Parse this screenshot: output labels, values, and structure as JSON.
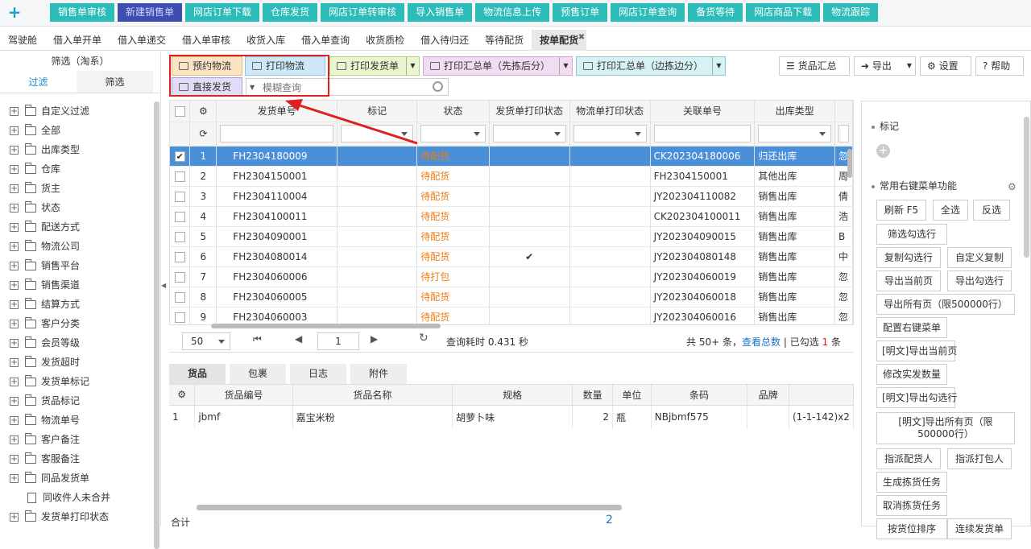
{
  "topnav": {
    "tabs": [
      "销售单审核",
      "新建销售单",
      "网店订单下载",
      "仓库发货",
      "网店订单转审核",
      "导入销售单",
      "物流信息上传",
      "预售订单",
      "网店订单查询",
      "备货等待",
      "网店商品下载",
      "物流跟踪"
    ],
    "selected_index": 1
  },
  "subtabs": [
    "驾驶舱",
    "借入单开单",
    "借入单递交",
    "借入单审核",
    "收货入库",
    "借入单查询",
    "收货质检",
    "借入待归还",
    "等待配货",
    "按单配货"
  ],
  "left": {
    "title": "筛选（淘系）",
    "tabs": [
      "过滤",
      "筛选"
    ],
    "tree": [
      "自定义过滤",
      "全部",
      "出库类型",
      "仓库",
      "货主",
      "状态",
      "配送方式",
      "物流公司",
      "销售平台",
      "销售渠道",
      "结算方式",
      "客户分类",
      "会员等级",
      "发货超时",
      "发货单标记",
      "货品标记",
      "物流单号",
      "客户备注",
      "客服备注",
      "同品发货单",
      "同收件人未合并",
      "发货单打印状态"
    ]
  },
  "toolbar": {
    "reserve_logistics": "预约物流",
    "print_logistics": "打印物流",
    "print_delivery": "打印发货单",
    "print_summary_pick_first": "打印汇总单（先拣后分）",
    "print_summary_pick_while": "打印汇总单（边拣边分）",
    "direct_ship": "直接发货",
    "fuzzy_placeholder": "模糊查询",
    "goods_summary": "货品汇总",
    "export": "导出",
    "settings": "设置",
    "help": "帮助"
  },
  "grid": {
    "columns": [
      "发货单号",
      "标记",
      "状态",
      "发货单打印状态",
      "物流单打印状态",
      "关联单号",
      "出库类型"
    ],
    "rows": [
      {
        "n": "1",
        "no": "FH2304180009",
        "status": "待配货",
        "print": "",
        "ref": "CK202304180006",
        "type": "归还出库",
        "x": "忽",
        "selected": true
      },
      {
        "n": "2",
        "no": "FH2304150001",
        "status": "待配货",
        "print": "",
        "ref": "FH2304150001",
        "type": "其他出库",
        "x": "周",
        "selected": false
      },
      {
        "n": "3",
        "no": "FH2304110004",
        "status": "待配货",
        "print": "",
        "ref": "JY202304110082",
        "type": "销售出库",
        "x": "倩",
        "selected": false
      },
      {
        "n": "4",
        "no": "FH2304100011",
        "status": "待配货",
        "print": "",
        "ref": "CK202304100011",
        "type": "销售出库",
        "x": "浩",
        "selected": false
      },
      {
        "n": "5",
        "no": "FH2304090001",
        "status": "待配货",
        "print": "",
        "ref": "JY202304090015",
        "type": "销售出库",
        "x": "B",
        "selected": false
      },
      {
        "n": "6",
        "no": "FH2304080014",
        "status": "待配货",
        "print": "✔",
        "ref": "JY202304080148",
        "type": "销售出库",
        "x": "中",
        "selected": false
      },
      {
        "n": "7",
        "no": "FH2304060006",
        "status": "待打包",
        "print": "",
        "ref": "JY202304060019",
        "type": "销售出库",
        "x": "忽",
        "selected": false
      },
      {
        "n": "8",
        "no": "FH2304060005",
        "status": "待配货",
        "print": "",
        "ref": "JY202304060018",
        "type": "销售出库",
        "x": "忽",
        "selected": false
      },
      {
        "n": "9",
        "no": "FH2304060003",
        "status": "待配货",
        "print": "",
        "ref": "JY202304060016",
        "type": "销售出库",
        "x": "忽",
        "selected": false
      }
    ]
  },
  "pager": {
    "page_size": "50",
    "page": "1",
    "query_time": "查询耗时 0.431 秒",
    "total_prefix": "共 50+ 条，",
    "total_link": "查看总数",
    "selected_prefix": " | 已勾选 ",
    "selected_count": "1",
    "selected_suffix": " 条"
  },
  "bottom_tabs": [
    "货品",
    "包裹",
    "日志",
    "附件"
  ],
  "detail": {
    "columns": [
      "货品编号",
      "货品名称",
      "规格",
      "数量",
      "单位",
      "条码",
      "品牌"
    ],
    "row": {
      "n": "1",
      "code": "jbmf",
      "name": "嘉宝米粉",
      "spec": "胡萝卜味",
      "qty": "2",
      "unit": "瓶",
      "barcode": "NBjbmf575",
      "brand": "",
      "extra": "(1-1-142)x2"
    },
    "footer_label": "合计",
    "footer_sum": "2"
  },
  "right": {
    "mark_header": "标记",
    "menu_header": "常用右键菜单功能",
    "buttons": [
      "刷新 F5",
      "全选",
      "反选",
      "筛选勾选行",
      "复制勾选行",
      "自定义复制",
      "导出当前页",
      "导出勾选行",
      "导出所有页（限500000行）",
      "配置右键菜单",
      "[明文]导出当前页",
      "修改实发数量",
      "[明文]导出勾选行",
      "[明文]导出所有页（限500000行）",
      "指派配货人",
      "指派打包人",
      "生成拣货任务",
      "取消拣货任务",
      "按货位排序",
      "连续发货单"
    ]
  },
  "colors": {
    "teal": "#2bbbb8",
    "selected_tab": "#3d4db0",
    "row_selected": "#4a90d9",
    "status_orange": "#f07a14",
    "highlight_red": "#e02020"
  }
}
